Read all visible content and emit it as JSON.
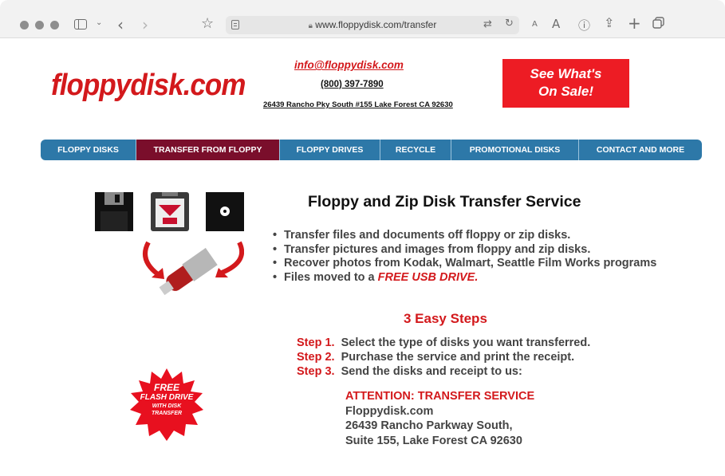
{
  "browser": {
    "url": "www.floppydisk.com/transfer",
    "font_small": "A",
    "font_large": "A"
  },
  "header": {
    "logo": "floppydisk.com",
    "email": "info@floppydisk.com",
    "phone": "(800) 397-7890",
    "address": "26439 Rancho Pky South #155 Lake Forest CA 92630",
    "sale_line1": "See What's",
    "sale_line2": "On Sale!"
  },
  "nav": {
    "items": [
      {
        "label": "FLOPPY DISKS"
      },
      {
        "label": "TRANSFER FROM FLOPPY"
      },
      {
        "label": "FLOPPY DRIVES"
      },
      {
        "label": "RECYCLE"
      },
      {
        "label": "PROMOTIONAL DISKS"
      },
      {
        "label": "CONTACT AND MORE"
      }
    ]
  },
  "main": {
    "heading": "Floppy and Zip Disk Transfer Service",
    "bullets": [
      "Transfer files and documents off floppy or zip disks.",
      "Transfer pictures and images from floppy and zip disks.",
      "Recover photos from Kodak, Walmart, Seattle Film Works programs"
    ],
    "bullet4_prefix": "Files moved to a ",
    "bullet4_em": "FREE USB DRIVE.",
    "steps_title": "3 Easy Steps",
    "steps": [
      {
        "label": "Step 1.",
        "text": "Select the type of disks you want transferred."
      },
      {
        "label": "Step 2.",
        "text": "Purchase the service and print the receipt."
      },
      {
        "label": "Step 3.",
        "text": "Send the disks and receipt to us:"
      }
    ],
    "address": {
      "attention": "ATTENTION: TRANSFER SERVICE",
      "line1": "Floppydisk.com",
      "line2": "26439 Rancho Parkway South,",
      "line3": "Suite 155, Lake Forest CA 92630"
    }
  },
  "badge": {
    "line1": "FREE",
    "line2": "FLASH DRIVE",
    "line3": "WITH DISK",
    "line4": "TRANSFER"
  },
  "colors": {
    "brand_red": "#d3191c",
    "nav_blue": "#2d78a8",
    "nav_active": "#7a0e2b",
    "sale_red": "#ed1c24"
  }
}
